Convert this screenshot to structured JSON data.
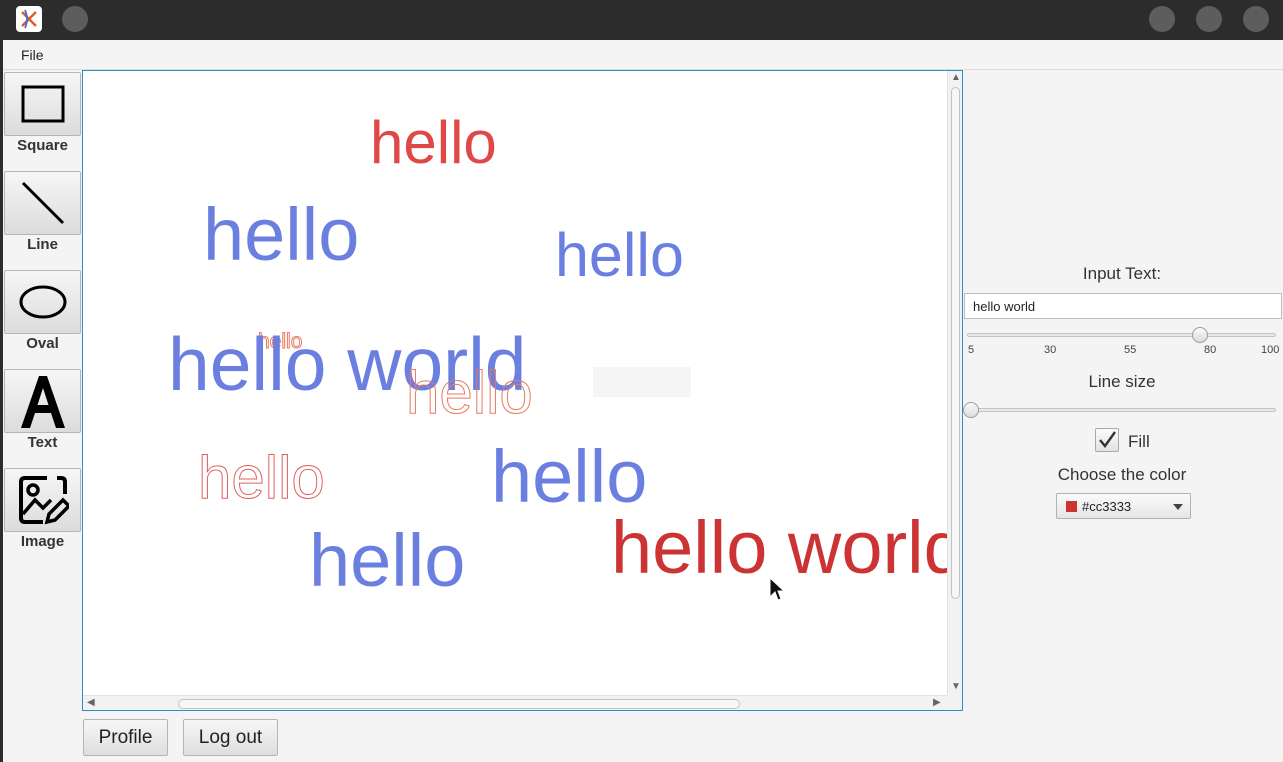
{
  "menu": {
    "file_label": "File"
  },
  "tools": [
    {
      "label": "Square",
      "icon": "square-icon"
    },
    {
      "label": "Line",
      "icon": "line-icon"
    },
    {
      "label": "Oval",
      "icon": "oval-icon"
    },
    {
      "label": "Text",
      "icon": "text-icon"
    },
    {
      "label": "Image",
      "icon": "image-icon"
    }
  ],
  "canvas": {
    "texts": [
      {
        "text": "hello",
        "color": "#e04848",
        "style": "filled"
      },
      {
        "text": "hello",
        "color": "#6b7fe0",
        "style": "filled"
      },
      {
        "text": "hello",
        "color": "#6b7fe0",
        "style": "filled"
      },
      {
        "text": "hello",
        "color": "#e8795e",
        "style": "outline"
      },
      {
        "text": "hello world",
        "color": "#6b7fe0",
        "style": "filled"
      },
      {
        "text": "hello",
        "color": "#e8795e",
        "style": "outline"
      },
      {
        "text": "hello",
        "color": "#e06060",
        "style": "outline"
      },
      {
        "text": "hello",
        "color": "#6b7fe0",
        "style": "filled"
      },
      {
        "text": "hello",
        "color": "#6b7fe0",
        "style": "filled"
      },
      {
        "text": "hello world",
        "color": "#cc3333",
        "style": "filled"
      }
    ]
  },
  "side_panel": {
    "input_label": "Input Text:",
    "input_value": "hello world",
    "size_ticks": [
      "5",
      "30",
      "55",
      "80",
      "100"
    ],
    "font_size_value": 76,
    "line_size_label": "Line size",
    "line_size_value": 0,
    "fill_label": "Fill",
    "fill_checked": true,
    "color_label": "Choose the color",
    "color_value": "#cc3333"
  },
  "buttons": {
    "profile": "Profile",
    "logout": "Log out"
  }
}
